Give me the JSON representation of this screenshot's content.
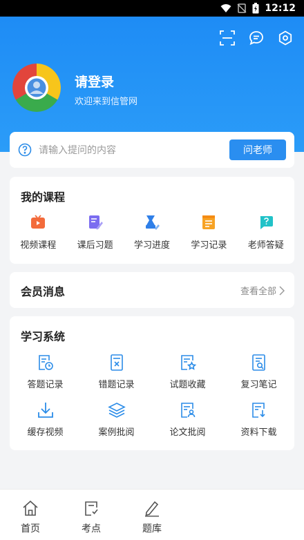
{
  "status_bar": {
    "time": "12:12"
  },
  "header": {
    "login_title": "请登录",
    "login_subtitle": "欢迎来到信管网",
    "icons": [
      "scan-icon",
      "message-icon",
      "settings-icon"
    ]
  },
  "search": {
    "placeholder": "请输入提问的内容",
    "button_label": "问老师"
  },
  "courses": {
    "title": "我的课程",
    "items": [
      {
        "label": "视频课程",
        "icon": "video-course-icon",
        "color": "#f36b3b"
      },
      {
        "label": "课后习题",
        "icon": "exercise-icon",
        "color": "#7b6cf0"
      },
      {
        "label": "学习进度",
        "icon": "progress-icon",
        "color": "#2f7fe8"
      },
      {
        "label": "学习记录",
        "icon": "record-icon",
        "color": "#f7a325"
      },
      {
        "label": "老师答疑",
        "icon": "qa-icon",
        "color": "#21c2c8"
      }
    ]
  },
  "member": {
    "title": "会员消息",
    "view_all": "查看全部"
  },
  "study": {
    "title": "学习系统",
    "items": [
      {
        "label": "答题记录",
        "icon": "answer-record-icon"
      },
      {
        "label": "错题记录",
        "icon": "wrong-record-icon"
      },
      {
        "label": "试题收藏",
        "icon": "favorite-icon"
      },
      {
        "label": "复习笔记",
        "icon": "notes-icon"
      },
      {
        "label": "缓存视频",
        "icon": "download-video-icon"
      },
      {
        "label": "案例批阅",
        "icon": "case-review-icon"
      },
      {
        "label": "论文批阅",
        "icon": "paper-review-icon"
      },
      {
        "label": "资料下载",
        "icon": "material-download-icon"
      }
    ],
    "icon_color": "#2b8ce8"
  },
  "tabbar": {
    "tabs": [
      {
        "label": "首页",
        "icon": "home-icon"
      },
      {
        "label": "考点",
        "icon": "exam-point-icon"
      },
      {
        "label": "题库",
        "icon": "question-bank-icon"
      }
    ]
  }
}
